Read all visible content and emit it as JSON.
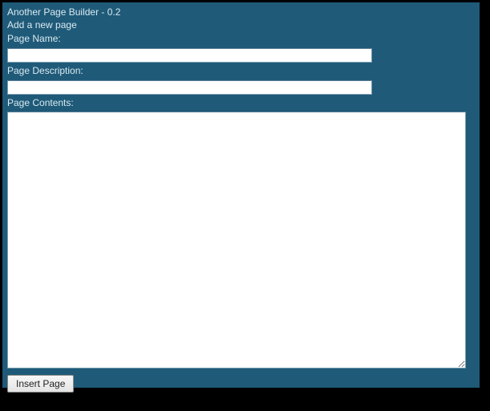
{
  "header": {
    "app_title": "Another Page Builder - 0.2",
    "sub_title": "Add a new page"
  },
  "form": {
    "page_name": {
      "label": "Page Name:",
      "value": ""
    },
    "page_description": {
      "label": "Page Description:",
      "value": ""
    },
    "page_contents": {
      "label": "Page Contents:",
      "value": ""
    },
    "submit_label": "Insert Page"
  }
}
